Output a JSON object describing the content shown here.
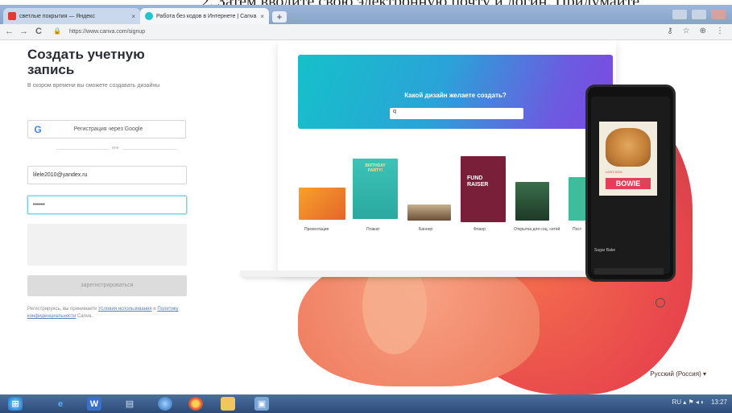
{
  "doc_text": "2. Затем вводите свою электронную почту и логин. Придумайте",
  "browser": {
    "tabs": [
      {
        "title": "светлые покрытия — Яндекс",
        "favicon_color": "#e53935",
        "close": "×"
      },
      {
        "title": "Работа без кодов в Интернете | Canva",
        "favicon_color": "#20c4cb",
        "close": "×"
      }
    ],
    "newtab": "+",
    "url": "https://www.canva.com/signup",
    "nav": {
      "back": "←",
      "forward": "→",
      "reload": "C",
      "lock": "🔒"
    },
    "right_icons": {
      "key": "⚷",
      "star": "☆",
      "account": "⊕",
      "menu": "⋮"
    }
  },
  "form": {
    "title": "Создать учетную запись",
    "subtitle": "В скором времени вы сможете создавать дизайны",
    "google_icon": "G",
    "google_button": "Регистрация через Google",
    "divider": "или",
    "email_value": "lilele2010@yandex.ru",
    "password_value": "••••••",
    "submit": "зарегистрироваться",
    "terms_prefix": "Регистрируясь, вы принимаете ",
    "terms_link1": "Условия использования",
    "terms_mid": " и ",
    "terms_link2": "Политику конфиденциальности",
    "terms_suffix": " Canva."
  },
  "illustration": {
    "question": "Какой дизайн желаете создать?",
    "search_value": "q",
    "thumb_labels": [
      "Презентация",
      "Плакат",
      "Баннер",
      "Флаер",
      "Открытка для соц. сетей",
      "Пост"
    ],
    "poster_text1": "BIRTHDAY PARTY!",
    "poster_text2": "FUND RAISER",
    "phone_name": "BOWIE",
    "phone_lost": "LOST DOG",
    "phone_toolbar": "Sugar Bake"
  },
  "language": "Русский (Россия) ▾",
  "taskbar": {
    "clock": "13:27",
    "tray": "RU ▴ ⚑ ◂ ◐"
  }
}
